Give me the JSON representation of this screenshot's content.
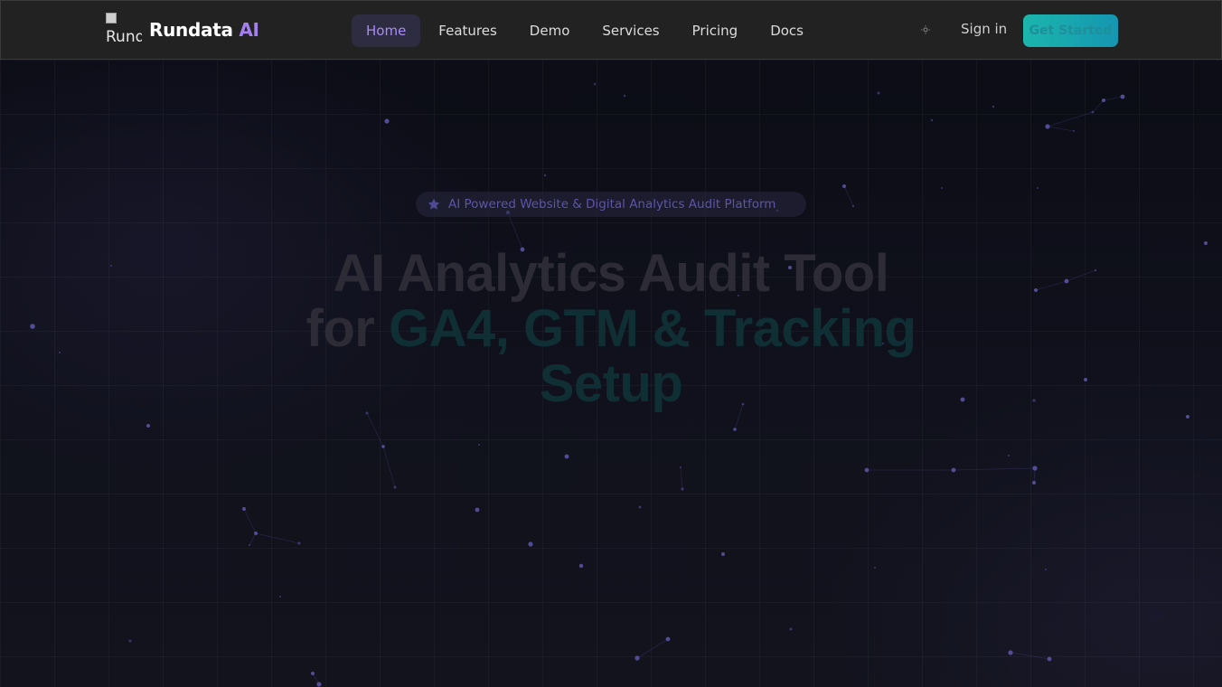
{
  "header": {
    "logo_alt": "Rund",
    "brand_name": "Rundata",
    "brand_accent": "AI",
    "nav": [
      {
        "label": "Home",
        "active": true
      },
      {
        "label": "Features",
        "active": false
      },
      {
        "label": "Demo",
        "active": false
      },
      {
        "label": "Services",
        "active": false
      },
      {
        "label": "Pricing",
        "active": false
      },
      {
        "label": "Docs",
        "active": false
      }
    ],
    "theme_toggle_icon": "sun-icon",
    "sign_in_label": "Sign in",
    "cta_label": "Get Started"
  },
  "hero": {
    "badge_icon": "star-icon",
    "badge_text": "AI Powered Website & Digital Analytics Audit Platform",
    "title_line1": "AI Analytics Audit Tool",
    "title_for": "for",
    "title_highlight_1": "GA4, GTM & Tracking",
    "title_highlight_2": "Setup"
  },
  "colors": {
    "background": "#0e0f1a",
    "header_bg": "#222222",
    "brand_accent": "#a47ff0",
    "nav_active": "#a98bf5",
    "cta_gradient_start": "#1bb6ac",
    "cta_gradient_end": "#1596b2",
    "particle": "#5a53a0"
  }
}
